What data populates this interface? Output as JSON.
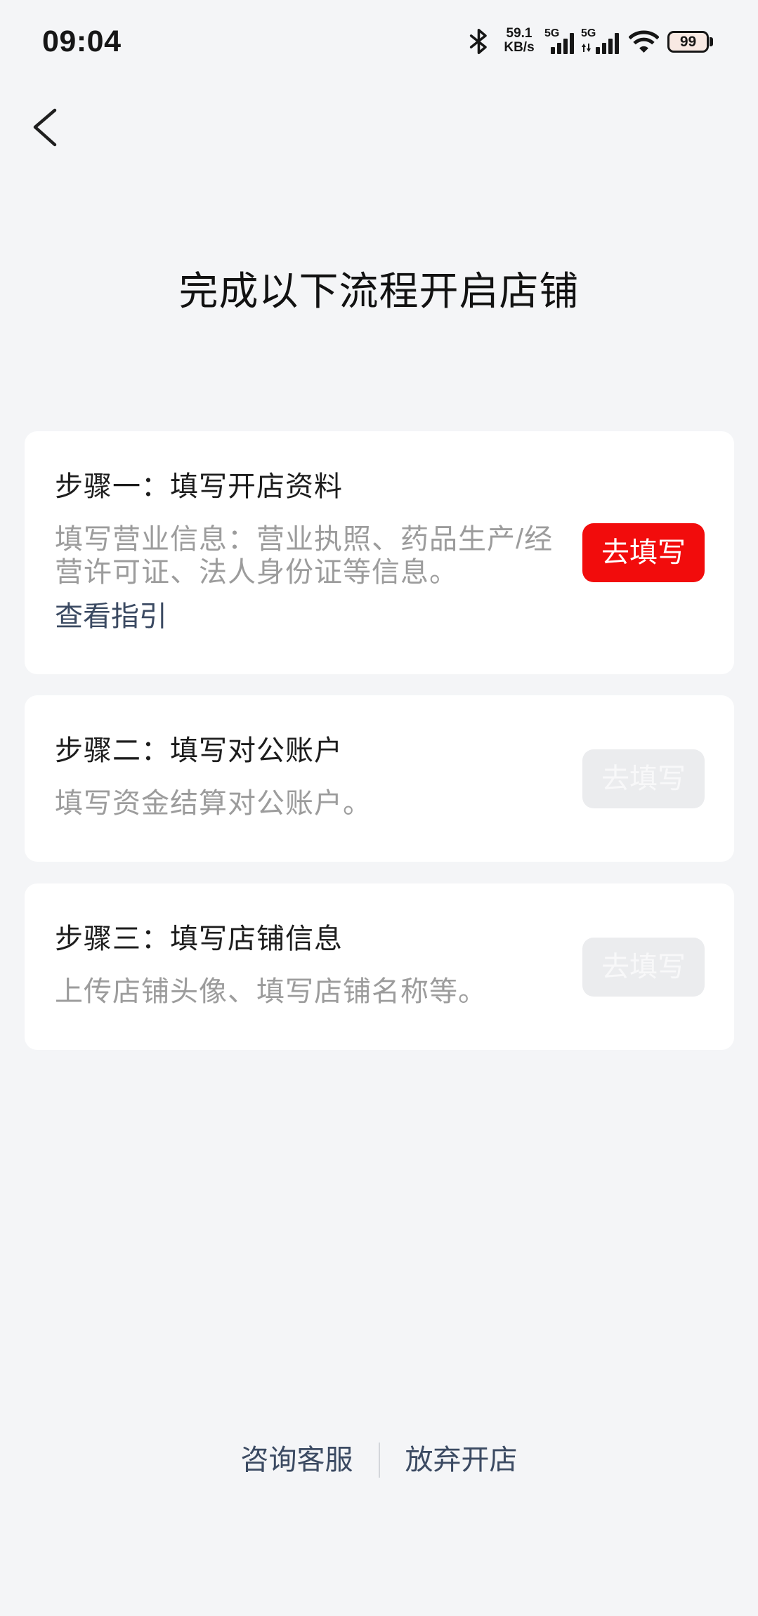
{
  "status_bar": {
    "time": "09:04",
    "bluetooth_icon": "bluetooth-icon",
    "net_speed_value": "59.1",
    "net_speed_unit": "KB/s",
    "sim1": {
      "network_type": "5G",
      "icon": "signal-icon",
      "signal_level": 4,
      "signal_max": 4
    },
    "sim2": {
      "network_type": "5G",
      "icon": "signal-icon",
      "activity_icon": "up-down-arrows-icon",
      "signal_level": 4,
      "signal_max": 4
    },
    "wifi": {
      "icon": "wifi-icon",
      "level": 3,
      "max": 3
    },
    "battery": {
      "icon": "battery-icon",
      "level": "99"
    }
  },
  "nav": {
    "back_icon": "chevron-left-icon"
  },
  "page_title": "完成以下流程开启店铺",
  "steps": [
    {
      "title": "步骤一：填写开店资料",
      "description": "填写营业信息：营业执照、药品生产/经营许可证、法人身份证等信息。",
      "guide_link": "查看指引",
      "button_label": "去填写",
      "button_enabled": true
    },
    {
      "title": "步骤二：填写对公账户",
      "description": "填写资金结算对公账户。",
      "button_label": "去填写",
      "button_enabled": false
    },
    {
      "title": "步骤三：填写店铺信息",
      "description": "上传店铺头像、填写店铺名称等。",
      "button_label": "去填写",
      "button_enabled": false
    }
  ],
  "footer": {
    "contact_label": "咨询客服",
    "abandon_label": "放弃开店"
  },
  "colors": {
    "background": "#f4f5f7",
    "primary_button": "#f20c0c",
    "link": "#3b4a62",
    "muted_text": "#9c9c9c",
    "disabled_button": "#ebecee",
    "icon_active": "#161616",
    "icon_inactive": "#c9c9c9"
  }
}
